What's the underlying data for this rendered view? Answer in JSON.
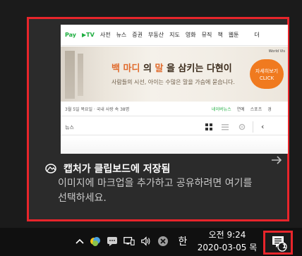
{
  "toast": {
    "title": "캡처가 클립보드에 저장됨",
    "body": "이미지에 마크업을 추가하고 공유하려면 여기를 선택하세요.",
    "expand_icon": "arrow-right-icon",
    "app_icon": "snip-sketch-icon"
  },
  "thumbnail": {
    "nav_pay": "Pay",
    "nav_tv": "▶TV",
    "nav_items": [
      "사전",
      "뉴스",
      "증권",
      "부동산",
      "지도",
      "영화",
      "뮤직",
      "책",
      "웹툰"
    ],
    "nav_overflow": "더",
    "banner_headline_1": "백 마디",
    "banner_headline_2": "의 ",
    "banner_headline_3": "말",
    "banner_headline_4": "을 삼키는 다현이",
    "banner_sub": "사람들의 시선, 아이는 수많은 말을 가슴에 묻습니다.",
    "banner_cta_1": "자세히보기",
    "banner_cta_2": "CLICK",
    "banner_corner": "World Vis",
    "info_left": "3월 5일 목요일 · 국내 사랑 속 38명",
    "info_right": [
      "네이버뉴스",
      "연예",
      "스포츠",
      "경"
    ],
    "tools_label": "뉴스"
  },
  "taskbar": {
    "time": "오전 9:24",
    "date": "2020-03-05 목",
    "ime": "한",
    "notification_count": "1"
  },
  "colors": {
    "highlight": "#e8252b",
    "naver_green": "#1fae41",
    "toast_bg": "#2b2b2b"
  }
}
